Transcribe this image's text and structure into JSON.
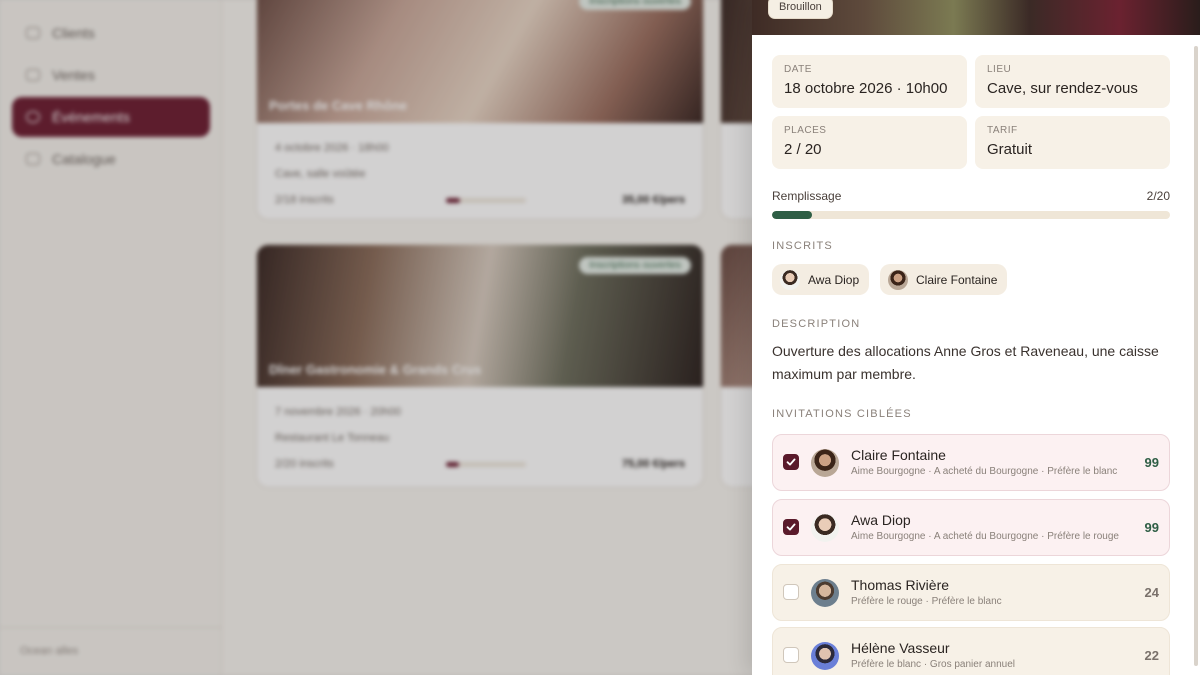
{
  "background": {
    "sidebar": {
      "items": [
        {
          "label": "Clients",
          "icon": "users-icon"
        },
        {
          "label": "Ventes",
          "icon": "cart-icon"
        },
        {
          "label": "Événements",
          "icon": "calendar-icon",
          "active": true
        },
        {
          "label": "Catalogue",
          "icon": "book-icon"
        }
      ],
      "footer": "Ocean alles"
    },
    "cards": [
      {
        "title": "Portes de Cave Rhône",
        "badge": "Inscriptions ouvertes",
        "date": "4 octobre 2026 · 18h00",
        "place": "Cave, salle voûtée",
        "seats": "2/18 inscrits",
        "price": "35,00 €/pers"
      },
      {
        "title": "Dîner Gastronomie & Grands Crus",
        "badge": "Inscriptions ouvertes",
        "date": "7 novembre 2026 · 20h00",
        "place": "Restaurant Le Tonneau",
        "seats": "2/20 inscrits",
        "price": "75,00 €/pers"
      }
    ]
  },
  "panel": {
    "status_badge": "Brouillon",
    "info": {
      "date_label": "DATE",
      "date_value": "18 octobre 2026 · 10h00",
      "place_label": "LIEU",
      "place_value": "Cave, sur rendez-vous",
      "seats_label": "PLACES",
      "seats_value": "2 / 20",
      "price_label": "TARIF",
      "price_value": "Gratuit"
    },
    "fill": {
      "label": "Remplissage",
      "count": "2/20",
      "fraction": 0.1
    },
    "attendees_title": "INSCRITS",
    "attendees": [
      {
        "name": "Awa Diop"
      },
      {
        "name": "Claire Fontaine"
      }
    ],
    "description_title": "DESCRIPTION",
    "description": "Ouverture des allocations Anne Gros et Raveneau, une caisse maximum par membre.",
    "invitations_title": "INVITATIONS CIBLÉES",
    "invitations": [
      {
        "name": "Claire Fontaine",
        "tags": "Aime Bourgogne · A acheté du Bourgogne · Préfère le blanc",
        "score": "99",
        "selected": true
      },
      {
        "name": "Awa Diop",
        "tags": "Aime Bourgogne · A acheté du Bourgogne · Préfère le rouge",
        "score": "99",
        "selected": true
      },
      {
        "name": "Thomas Rivière",
        "tags": "Préfère le rouge · Préfère le blanc",
        "score": "24",
        "selected": false
      },
      {
        "name": "Hélène Vasseur",
        "tags": "Préfère le blanc · Gros panier annuel",
        "score": "22",
        "selected": false
      }
    ]
  },
  "colors": {
    "brand": "#6d1f33",
    "accent_green": "#2e5e45",
    "card_bg": "#f7f1e7"
  }
}
